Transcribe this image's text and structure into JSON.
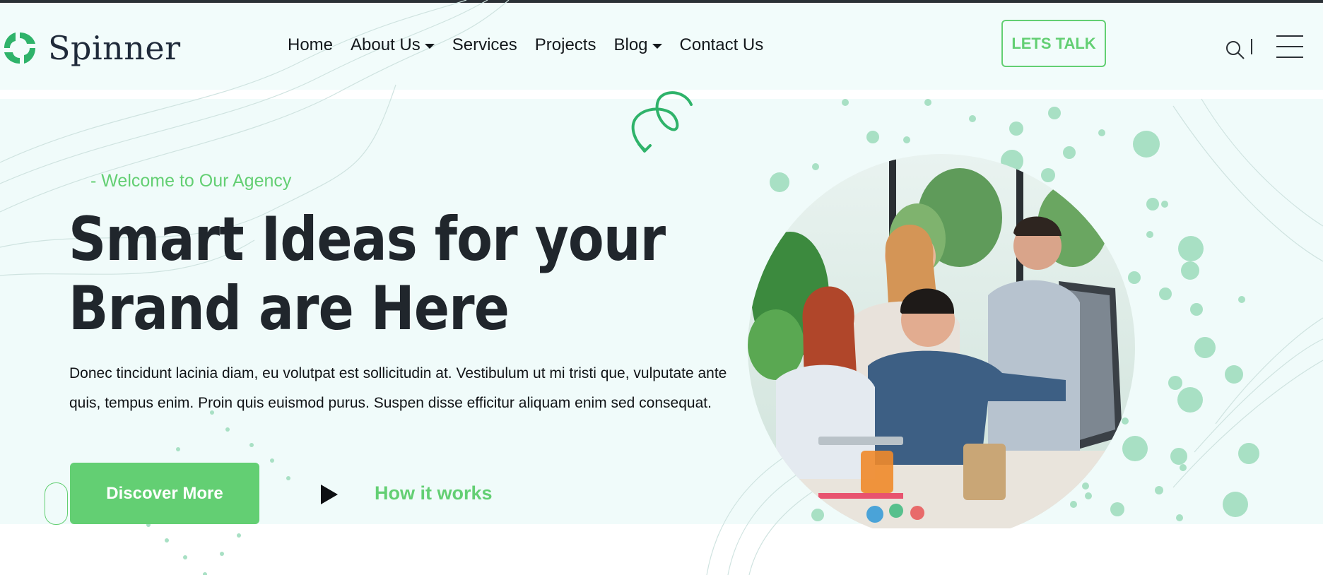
{
  "brand": {
    "name": "Spinner",
    "accent": "#63cf73",
    "dark": "#20262c"
  },
  "nav": {
    "items": [
      {
        "label": "Home",
        "dropdown": false
      },
      {
        "label": "About Us",
        "dropdown": true
      },
      {
        "label": "Services",
        "dropdown": false
      },
      {
        "label": "Projects",
        "dropdown": false
      },
      {
        "label": "Blog",
        "dropdown": true
      },
      {
        "label": "Contact Us",
        "dropdown": false
      }
    ],
    "cta_label": "LETS TALK",
    "icons": {
      "search": "search-icon",
      "menu": "hamburger-menu-icon",
      "caret": "caret-down-icon"
    }
  },
  "hero": {
    "eyebrow": "- Welcome to Our Agency",
    "headline_line1": "Smart Ideas for your",
    "headline_line2": "Brand are Here",
    "description": "Donec tincidunt lacinia diam, eu volutpat est sollicitudin at. Vestibulum ut mi tristi que, vulputate ante quis, tempus enim. Proin quis euismod purus. Suspen disse efficitur aliquam enim sed consequat.",
    "primary_button": "Discover More",
    "video_link": "How it works",
    "icons": {
      "play": "play-icon",
      "squiggle": "squiggle-arrow-icon"
    }
  }
}
